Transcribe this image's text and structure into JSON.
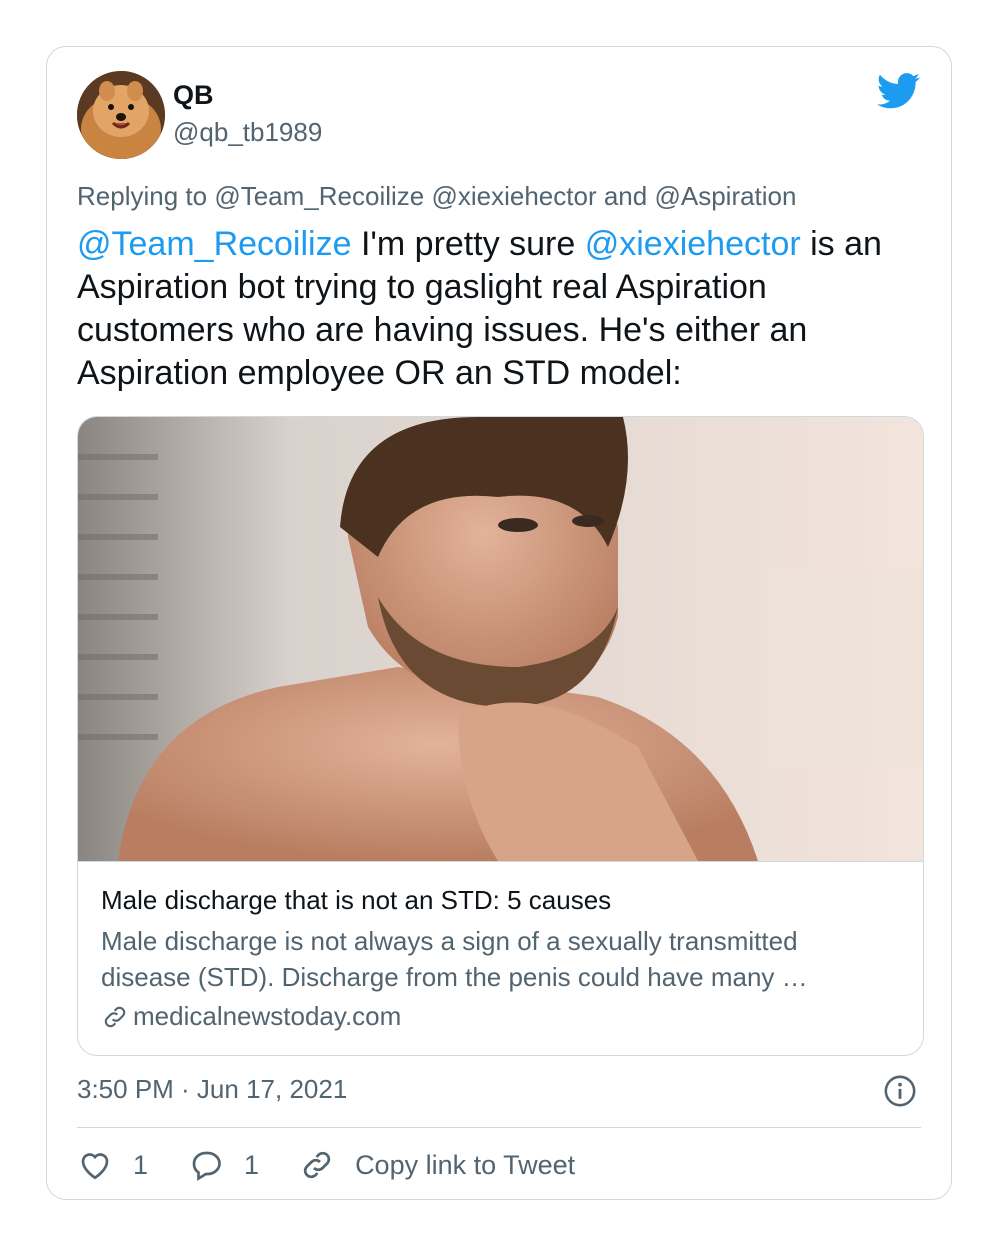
{
  "author": {
    "display_name": "QB",
    "handle": "@qb_tb1989",
    "avatar_icon": "dog-avatar"
  },
  "brand": {
    "icon": "twitter-bird-icon",
    "color": "#1d9bf0"
  },
  "reply": {
    "prefix": "Replying to",
    "mention_1": "@Team_Recoilize",
    "mention_2": "@xiexiehector",
    "joiner": "and",
    "mention_3": "@Aspiration"
  },
  "tweet": {
    "mention_1": "@Team_Recoilize",
    "text_1": " I'm pretty sure ",
    "mention_2": "@xiexiehector",
    "text_2": " is an Aspiration bot trying to gaslight real Aspiration customers who are having issues. He's either an Aspiration employee OR an STD model:"
  },
  "link_card": {
    "title": "Male discharge that is not an STD: 5 causes",
    "description": "Male discharge is not always a sign of a sexually transmitted disease (STD). Discharge from the penis could have many …",
    "domain": "medicalnewstoday.com",
    "image_alt": "shirtless bearded man resting chin on clasped hands"
  },
  "meta": {
    "timestamp": "3:50 PM · Jun 17, 2021"
  },
  "actions": {
    "like_count": "1",
    "reply_count": "1",
    "copy_label": "Copy link to Tweet"
  },
  "colors": {
    "accent": "#1d9bf0",
    "secondary_text": "#536471",
    "border": "#cfd9de"
  }
}
